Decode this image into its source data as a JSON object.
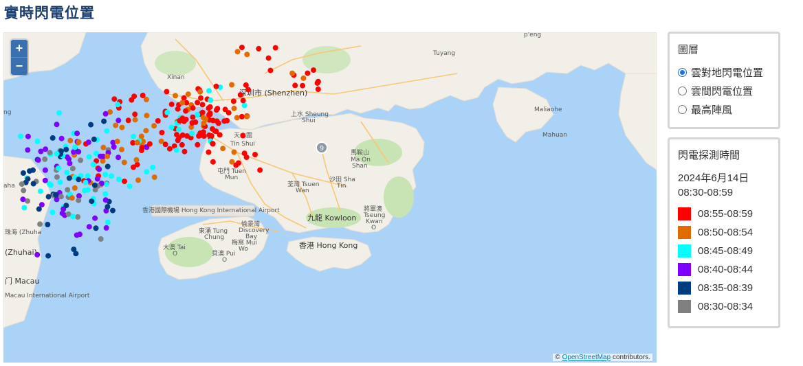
{
  "page": {
    "title": "實時閃電位置"
  },
  "map": {
    "zoom_in": "+",
    "zoom_out": "−",
    "attribution_symbol": "©",
    "attribution_link": "OpenStreetMap",
    "attribution_suffix": " contributors.",
    "labels": {
      "shenzhen": "深圳市 (Shenzhen)",
      "xinan": "Xinan",
      "tuyang": "Tuyang",
      "peng": "p'eng",
      "maliaohe": "Maliaohe",
      "mahuan": "Mahuan",
      "sheung_shui_cn": "上水 Sheung",
      "sheung_shui_en": "Shui",
      "yuen_long_cn": "天水圍",
      "yuen_long_en": "Tin Shui",
      "tuen_mun_cn": "屯門 Tuen",
      "tuen_mun_en": "Mun",
      "ma_on_shan_cn": "馬鞍山",
      "ma_on_shan_en": "Ma On",
      "ma_on_shan_en2": "Shan",
      "shatin_cn": "沙田 Sha",
      "shatin_en": "Tin",
      "tsuen_wan_cn": "荃灣 Tsuen",
      "tsuen_wan_en": "Wan",
      "kowloon": "九龍 Kowloon",
      "hong_kong": "香港 Hong Kong",
      "tko_cn": "將軍澳",
      "tko_en1": "Tseung",
      "tko_en2": "Kwan",
      "tko_en3": "O",
      "airport": "香港國際機場 Hong Kong International Airport",
      "tung_chung_cn": "東涌 Tung",
      "tung_chung_en": "Chung",
      "discovery_cn": "愉景灣",
      "discovery_en1": "Discovery",
      "discovery_en2": "Bay",
      "mui_wo_cn": "梅窩 Mui",
      "mui_wo_en": "Wo",
      "tai_o_cn": "大澳 Tai",
      "tai_o_en": "O",
      "pui_o_cn": "貝澳 Pui",
      "pui_o_en": "O",
      "zhuhai1": "珠海 (Zhuha",
      "zhuhai2": "(Zhuhai)",
      "macau": "门 Macau",
      "macau_airport": "Macau International Airport",
      "aha": "aha",
      "ng": "ng",
      "route9": "9"
    }
  },
  "layers": {
    "title": "圖層",
    "options": [
      {
        "label": "雲對地閃電位置",
        "selected": true
      },
      {
        "label": "雲間閃電位置",
        "selected": false
      },
      {
        "label": "最高陣風",
        "selected": false
      }
    ]
  },
  "time_legend": {
    "title": "閃電探測時間",
    "date": "2024年6月14日",
    "range": "08:30-08:59",
    "items": [
      {
        "label": "08:55-08:59",
        "color": "#ff0000"
      },
      {
        "label": "08:50-08:54",
        "color": "#e06c00"
      },
      {
        "label": "08:45-08:49",
        "color": "#00ffff"
      },
      {
        "label": "08:40-08:44",
        "color": "#8000ff"
      },
      {
        "label": "08:35-08:39",
        "color": "#003c80"
      },
      {
        "label": "08:30-08:34",
        "color": "#808080"
      }
    ]
  },
  "colors": {
    "sea": "#aad3f7",
    "land": "#f2efe9",
    "green": "#c8e4b4",
    "road": "#f8c776",
    "accent": "#1c3f6e"
  }
}
